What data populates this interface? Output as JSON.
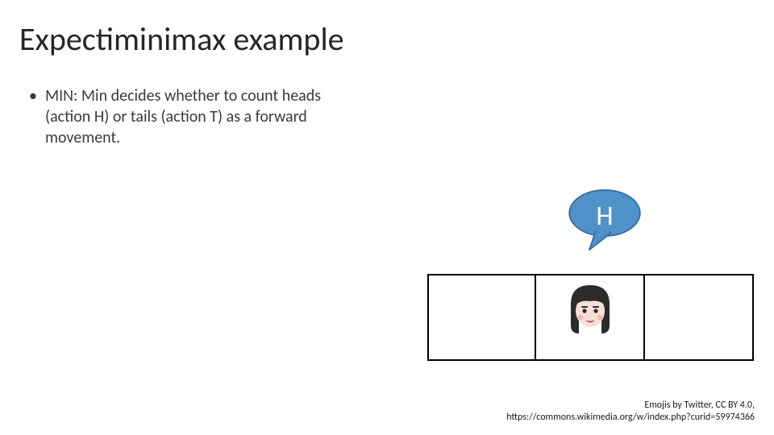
{
  "title": "Expectiminimax example",
  "bullet": {
    "marker": "•",
    "text": "MIN: Min decides whether to count heads (action H) or tails (action T) as a forward movement."
  },
  "bubble": {
    "letter": "H",
    "fill": "#4f92c9",
    "stroke": "#3b6fa0"
  },
  "board": {
    "cells": 3,
    "face_cell_index": 1
  },
  "face": {
    "skin": "#f6e0d6",
    "hair": "#2b2b2b",
    "mouth": "#c24a55",
    "blush": "#f4b6b2",
    "eye": "#2b2b2b"
  },
  "attribution": {
    "line1": "Emojis by Twitter, CC BY 4.0,",
    "line2": "https://commons.wikimedia.org/w/index.php?curid=59974366"
  }
}
